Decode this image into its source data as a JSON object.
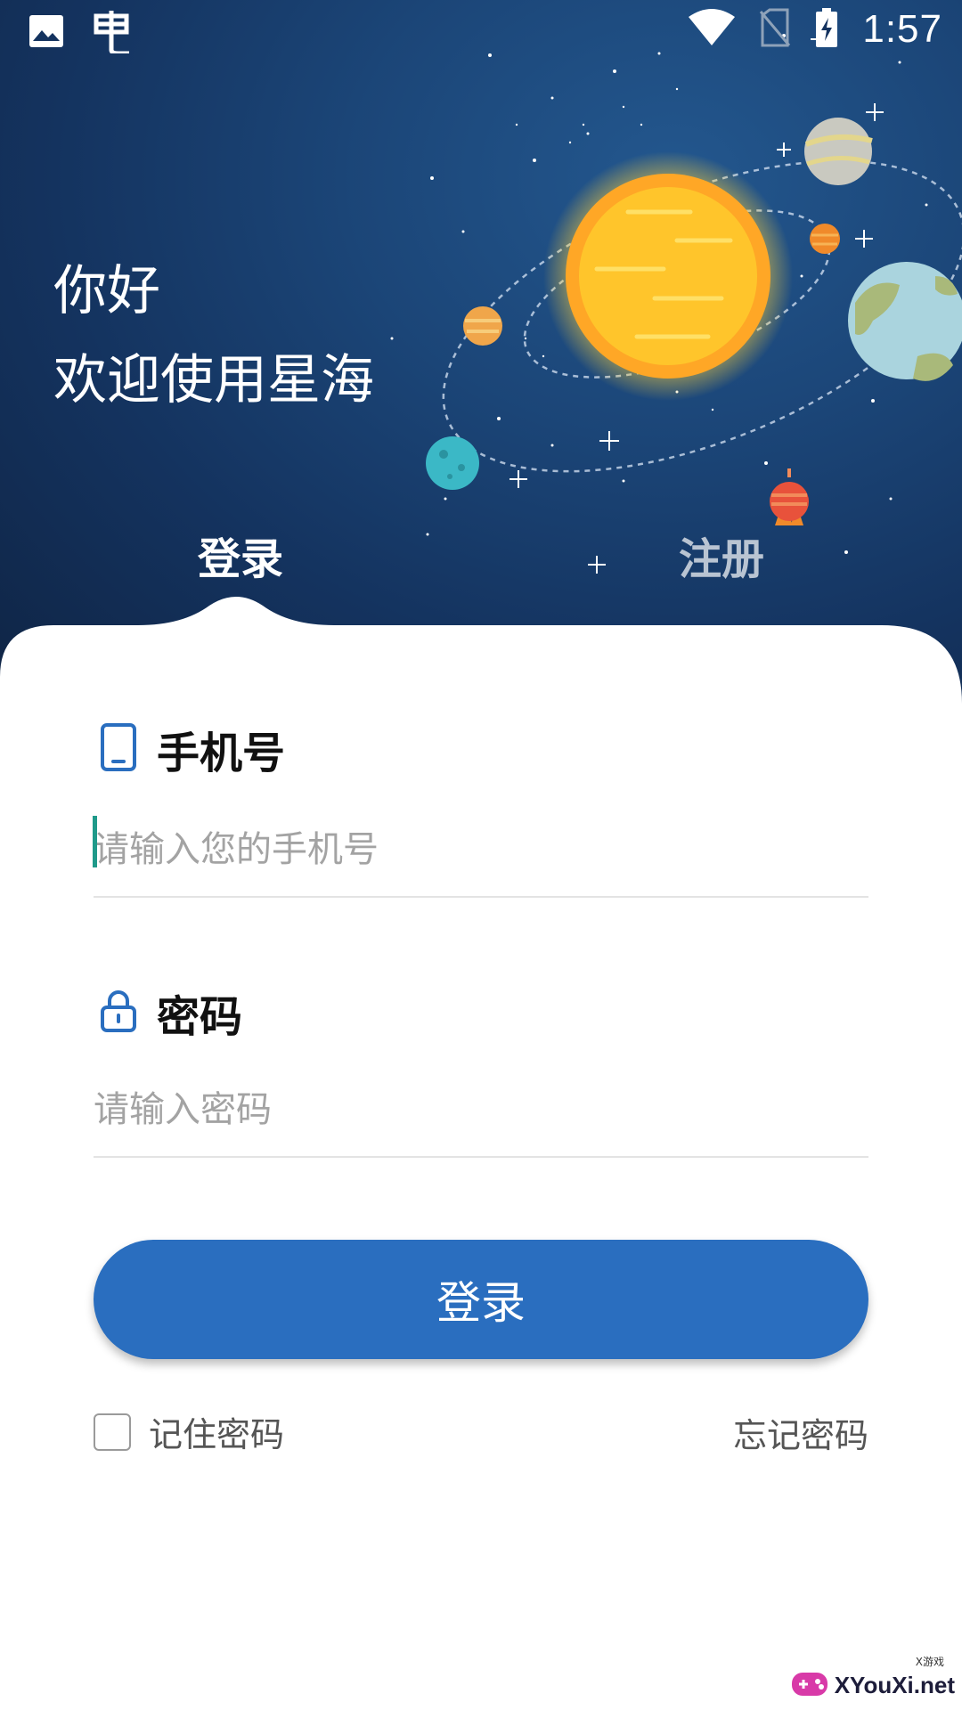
{
  "status_bar": {
    "time": "1:57",
    "icons": [
      "image-icon",
      "bug-icon",
      "wifi-icon",
      "no-sim-icon",
      "battery-charging-icon"
    ]
  },
  "hero": {
    "greeting": "你好",
    "welcome": "欢迎使用星海"
  },
  "tabs": [
    {
      "label": "登录",
      "active": true
    },
    {
      "label": "注册",
      "active": false
    }
  ],
  "form": {
    "phone": {
      "label": "手机号",
      "icon": "phone-icon",
      "placeholder": "请输入您的手机号",
      "value": ""
    },
    "password": {
      "label": "密码",
      "icon": "lock-icon",
      "placeholder": "请输入密码",
      "value": ""
    },
    "submit_label": "登录",
    "remember_label": "记住密码",
    "remember_checked": false,
    "forgot_label": "忘记密码"
  },
  "watermark": {
    "text": "XYouXi.net",
    "small": "X游戏"
  },
  "colors": {
    "primary": "#2a6ebf",
    "hero_dark": "#14335f",
    "caret": "#1f9a8a"
  }
}
